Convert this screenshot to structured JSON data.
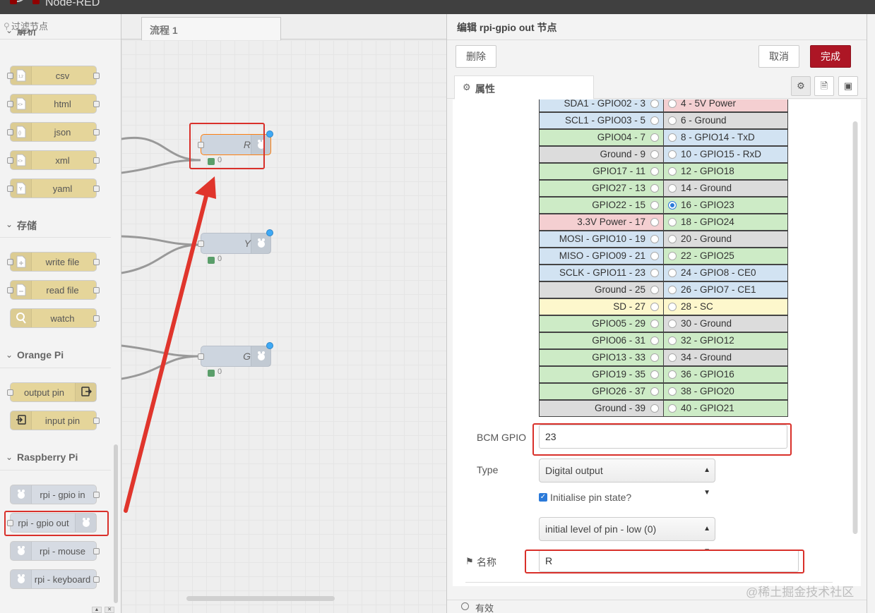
{
  "app": {
    "title": "Node-RED"
  },
  "palette": {
    "filter_placeholder": "过滤节点",
    "categories": [
      {
        "label": "解析",
        "nodes": [
          "csv",
          "html",
          "json",
          "xml",
          "yaml"
        ]
      },
      {
        "label": "存储",
        "nodes": [
          "write file",
          "read file",
          "watch"
        ]
      },
      {
        "label": "Orange Pi",
        "nodes": [
          "output pin",
          "input pin"
        ]
      },
      {
        "label": "Raspberry Pi",
        "nodes": [
          "rpi - gpio in",
          "rpi - gpio out",
          "rpi - mouse",
          "rpi - keyboard"
        ]
      }
    ]
  },
  "workspace": {
    "tab_label": "流程 1",
    "nodes": [
      {
        "label": "R",
        "status": "0"
      },
      {
        "label": "Y",
        "status": "0"
      },
      {
        "label": "G",
        "status": "0"
      }
    ]
  },
  "editor": {
    "title": "编辑 rpi-gpio out 节点",
    "delete_label": "删除",
    "cancel_label": "取消",
    "done_label": "完成",
    "tab_properties": "属性",
    "pins_left": [
      {
        "label": "SDA1 - GPIO02 - 3",
        "color": "#d2e3f2"
      },
      {
        "label": "SCL1 - GPIO03 - 5",
        "color": "#d2e3f2"
      },
      {
        "label": "GPIO04 - 7",
        "color": "#cdebc6"
      },
      {
        "label": "Ground - 9",
        "color": "#dcdcdc"
      },
      {
        "label": "GPIO17 - 11",
        "color": "#cdebc6"
      },
      {
        "label": "GPIO27 - 13",
        "color": "#cdebc6"
      },
      {
        "label": "GPIO22 - 15",
        "color": "#cdebc6"
      },
      {
        "label": "3.3V Power - 17",
        "color": "#f4cfd1"
      },
      {
        "label": "MOSI - GPIO10 - 19",
        "color": "#d2e3f2"
      },
      {
        "label": "MISO - GPIO09 - 21",
        "color": "#d2e3f2"
      },
      {
        "label": "SCLK - GPIO11 - 23",
        "color": "#d2e3f2"
      },
      {
        "label": "Ground - 25",
        "color": "#dcdcdc"
      },
      {
        "label": "SD - 27",
        "color": "#fdf7cc"
      },
      {
        "label": "GPIO05 - 29",
        "color": "#cdebc6"
      },
      {
        "label": "GPIO06 - 31",
        "color": "#cdebc6"
      },
      {
        "label": "GPIO13 - 33",
        "color": "#cdebc6"
      },
      {
        "label": "GPIO19 - 35",
        "color": "#cdebc6"
      },
      {
        "label": "GPIO26 - 37",
        "color": "#cdebc6"
      },
      {
        "label": "Ground - 39",
        "color": "#dcdcdc"
      }
    ],
    "pins_right": [
      {
        "label": "4 - 5V Power",
        "color": "#f4cfd1"
      },
      {
        "label": "6 - Ground",
        "color": "#dcdcdc"
      },
      {
        "label": "8 - GPIO14 - TxD",
        "color": "#d2e3f2"
      },
      {
        "label": "10 - GPIO15 - RxD",
        "color": "#d2e3f2"
      },
      {
        "label": "12 - GPIO18",
        "color": "#cdebc6"
      },
      {
        "label": "14 - Ground",
        "color": "#dcdcdc"
      },
      {
        "label": "16 - GPIO23",
        "color": "#cdebc6",
        "selected": true
      },
      {
        "label": "18 - GPIO24",
        "color": "#cdebc6"
      },
      {
        "label": "20 - Ground",
        "color": "#dcdcdc"
      },
      {
        "label": "22 - GPIO25",
        "color": "#cdebc6"
      },
      {
        "label": "24 - GPIO8 - CE0",
        "color": "#d2e3f2"
      },
      {
        "label": "26 - GPIO7 - CE1",
        "color": "#d2e3f2"
      },
      {
        "label": "28 - SC",
        "color": "#fdf7cc"
      },
      {
        "label": "30 - Ground",
        "color": "#dcdcdc"
      },
      {
        "label": "32 - GPIO12",
        "color": "#cdebc6"
      },
      {
        "label": "34 - Ground",
        "color": "#dcdcdc"
      },
      {
        "label": "36 - GPIO16",
        "color": "#cdebc6"
      },
      {
        "label": "38 - GPIO20",
        "color": "#cdebc6"
      },
      {
        "label": "40 - GPIO21",
        "color": "#cdebc6"
      }
    ],
    "bcm_gpio_label": "BCM GPIO",
    "bcm_gpio_value": "23",
    "type_label": "Type",
    "type_value": "Digital output",
    "init_checkbox_label": "Initialise pin state?",
    "init_level_value": "initial level of pin - low (0)",
    "name_label": "名称",
    "name_value": "R",
    "footer_label": "有效"
  },
  "watermark": "@稀土掘金技术社区",
  "colors": {
    "accent": "#ad1625",
    "highlight": "#d9302a"
  }
}
